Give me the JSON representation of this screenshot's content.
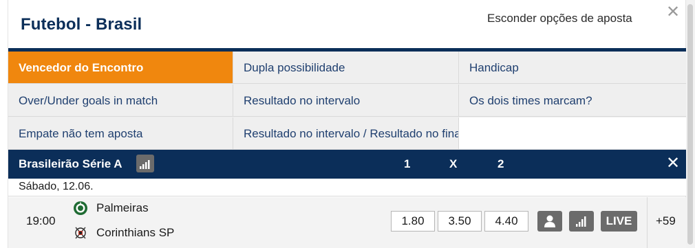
{
  "header": {
    "title": "Futebol - Brasil",
    "hide_options": "Esconder opções de aposta",
    "close_symbol": "✕"
  },
  "markets": [
    [
      "Vencedor do Encontro",
      "Dupla possibilidade",
      "Handicap"
    ],
    [
      "Over/Under goals in match",
      "Resultado no intervalo",
      "Os dois times marcam?"
    ],
    [
      "Empate não tem aposta",
      "Resultado no intervalo / Resultado no final",
      ""
    ]
  ],
  "active_market": "Vencedor do Encontro",
  "league": {
    "name": "Brasileirão Série A",
    "col_1": "1",
    "col_x": "X",
    "col_2": "2",
    "close_symbol": "✕"
  },
  "date": "Sábado, 12.06.",
  "match": {
    "time": "19:00",
    "home": "Palmeiras",
    "away": "Corinthians SP",
    "odds": {
      "home": "1.80",
      "draw": "3.50",
      "away": "4.40"
    },
    "live_label": "LIVE",
    "more": "+59"
  },
  "colors": {
    "navy": "#0b2e59",
    "accent_orange": "#f0870e",
    "grid_bg": "#efefef",
    "icon_gray": "#6b6b6b"
  },
  "icons": [
    "close-icon",
    "stats-icon",
    "palmeiras-crest-icon",
    "corinthians-crest-icon",
    "lineup-icon",
    "live-label"
  ]
}
